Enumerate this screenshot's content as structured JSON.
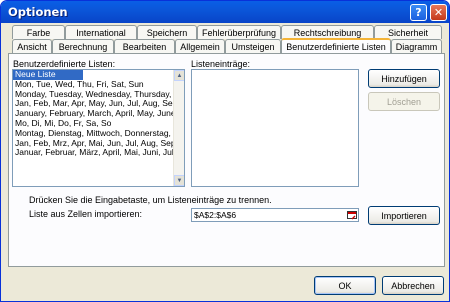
{
  "window": {
    "title": "Optionen",
    "help_icon": "?",
    "close_icon": "✕"
  },
  "tabs_row1": [
    "Farbe",
    "International",
    "Speichern",
    "Fehlerüberprüfung",
    "Rechtschreibung",
    "Sicherheit"
  ],
  "tabs_row2": [
    "Ansicht",
    "Berechnung",
    "Bearbeiten",
    "Allgemein",
    "Umsteigen",
    "Benutzerdefinierte Listen",
    "Diagramm"
  ],
  "active_tab": "Benutzerdefinierte Listen",
  "lists": {
    "label": "Benutzerdefinierte Listen:",
    "items": [
      "Neue Liste",
      "Mon, Tue, Wed, Thu, Fri, Sat, Sun",
      "Monday, Tuesday, Wednesday, Thursday, F",
      "Jan, Feb, Mar, Apr, May, Jun, Jul, Aug, Sep",
      "January, February, March, April, May, June",
      "Mo, Di, Mi, Do, Fr, Sa, So",
      "Montag, Dienstag, Mittwoch, Donnerstag, F",
      "Jan, Feb, Mrz, Apr, Mai, Jun, Jul, Aug, Sep,",
      "Januar, Februar, März, April, Mai, Juni, Juli,"
    ],
    "selected_index": 0
  },
  "entries": {
    "label": "Listeneinträge:"
  },
  "buttons": {
    "add": "Hinzufügen",
    "delete": "Löschen",
    "import": "Importieren",
    "ok": "OK",
    "cancel": "Abbrechen"
  },
  "hint": "Drücken Sie die Eingabetaste, um Listeneinträge zu trennen.",
  "import_field": {
    "label": "Liste aus Zellen importieren:",
    "value": "$A$2:$A$6",
    "icon": "range-select-icon"
  },
  "scroll": {
    "up": "▲",
    "down": "▼"
  }
}
